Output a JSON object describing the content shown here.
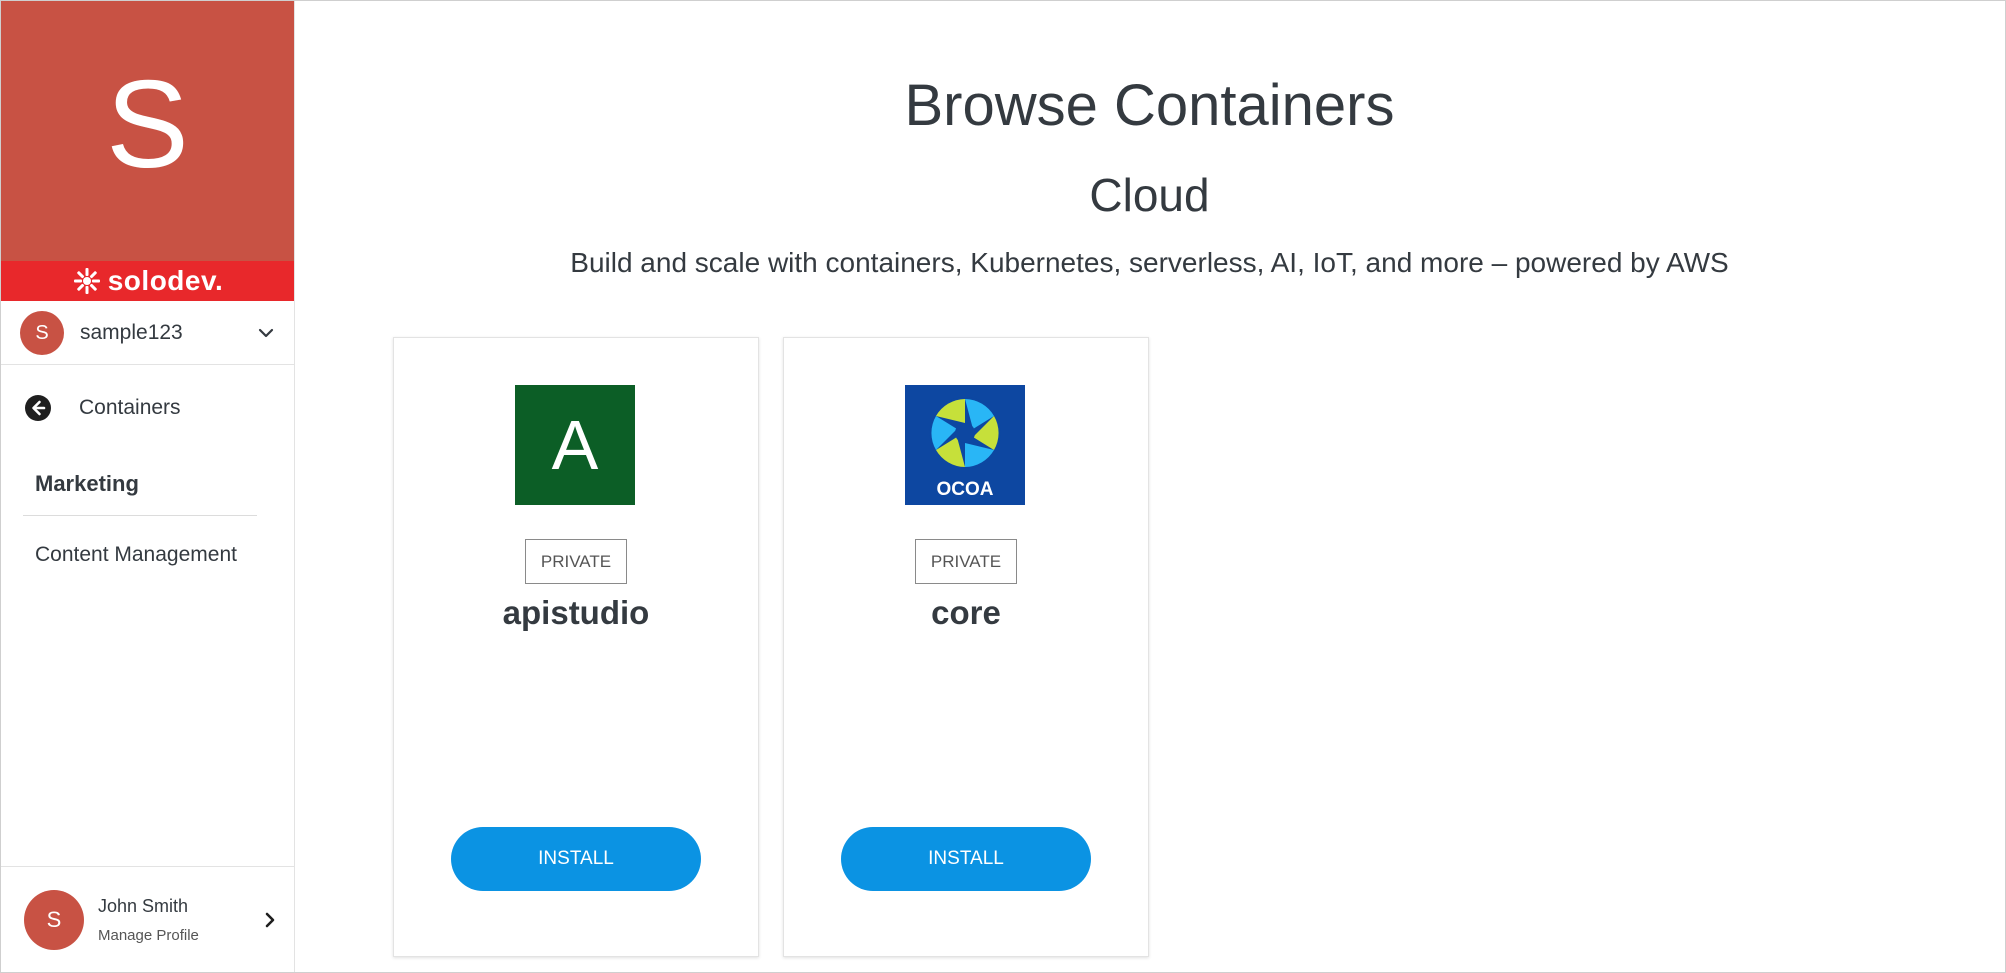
{
  "sidebar": {
    "brand_letter": "S",
    "brand_name": "solodev.",
    "account": {
      "avatar_letter": "S",
      "name": "sample123"
    },
    "back_label": "Containers",
    "section_title": "Marketing",
    "nav_items": [
      {
        "label": "Content Management"
      }
    ],
    "profile": {
      "avatar_letter": "S",
      "name": "John Smith",
      "subtitle": "Manage Profile"
    }
  },
  "main": {
    "title": "Browse Containers",
    "subtitle": "Cloud",
    "description": "Build and scale with containers, Kubernetes, serverless, AI, IoT, and more – powered by AWS",
    "cards": [
      {
        "logo_letter": "A",
        "logo_color": "#0c5e26",
        "badge": "PRIVATE",
        "name": "apistudio",
        "button": "INSTALL"
      },
      {
        "logo_text": "OCOA",
        "logo_color": "#0d47a1",
        "badge": "PRIVATE",
        "name": "core",
        "button": "INSTALL"
      }
    ]
  },
  "colors": {
    "brand": "#c85244",
    "brand_bar": "#e8282b",
    "button": "#0b93e3"
  }
}
